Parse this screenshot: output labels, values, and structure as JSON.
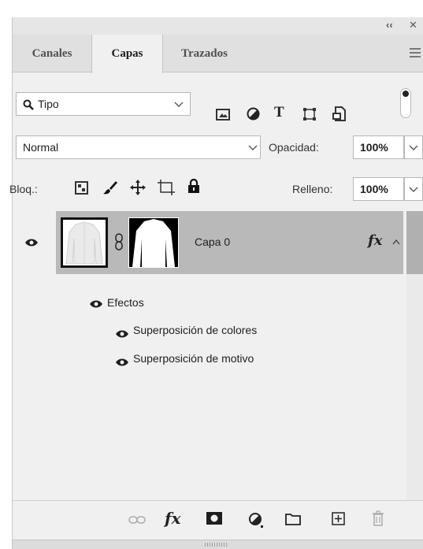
{
  "panel_controls": {
    "collapse": "‹‹",
    "close": "✕"
  },
  "tabs": [
    {
      "label": "Canales",
      "active": false
    },
    {
      "label": "Capas",
      "active": true
    },
    {
      "label": "Trazados",
      "active": false
    }
  ],
  "filter": {
    "kind_label": "Tipo",
    "filter_icons": [
      "image-filter-icon",
      "adjustment-filter-icon",
      "type-filter-icon",
      "shape-filter-icon",
      "smartobject-filter-icon"
    ]
  },
  "blend": {
    "mode": "Normal",
    "opacity_label": "Opacidad:",
    "opacity_value": "100%"
  },
  "lock": {
    "label": "Bloq.:",
    "fill_label": "Relleno:",
    "fill_value": "100%"
  },
  "layers": [
    {
      "name": "Capa 0",
      "visible": true,
      "fx_label": "fx",
      "effects_label": "Efectos",
      "effects": [
        "Superposición de colores",
        "Superposición de motivo"
      ]
    }
  ],
  "bottom_toolbar": [
    "link-layers-icon",
    "fx-icon",
    "mask-icon",
    "adjustment-icon",
    "group-folder-icon",
    "new-layer-icon",
    "trash-icon"
  ],
  "colors": {
    "selected_row": "#b9b9b9",
    "panel_bg": "#f0f0f0",
    "tab_bg": "#e0e0e0"
  }
}
